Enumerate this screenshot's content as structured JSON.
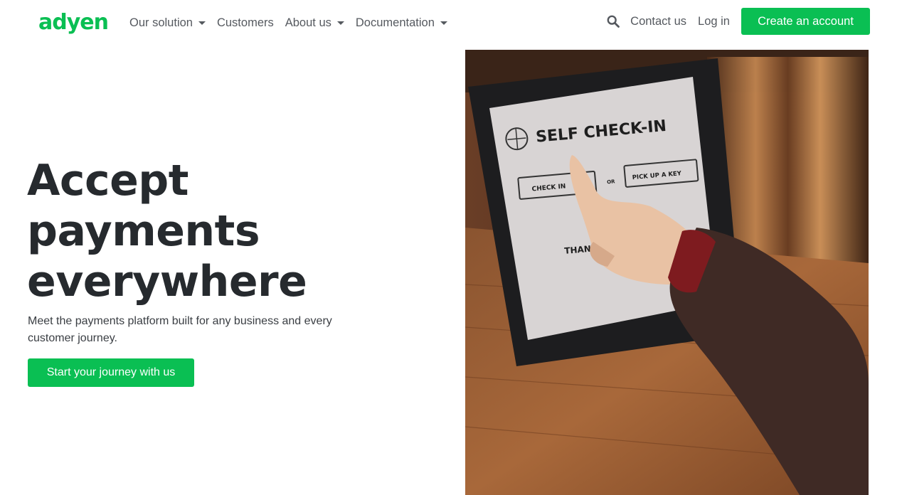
{
  "header": {
    "logo_text": "adyen",
    "nav": [
      {
        "label": "Our solution",
        "has_dropdown": true
      },
      {
        "label": "Customers",
        "has_dropdown": false
      },
      {
        "label": "About us",
        "has_dropdown": true
      },
      {
        "label": "Documentation",
        "has_dropdown": true
      }
    ],
    "search_icon": "search-icon",
    "contact_label": "Contact us",
    "login_label": "Log in",
    "cta_label": "Create an account"
  },
  "hero": {
    "title_lines": [
      "Accept",
      "payments",
      "everywhere"
    ],
    "subtitle_lines": [
      "Meet the payments platform built for any business and every",
      "customer journey."
    ],
    "button_label": "Start your journey with us"
  },
  "video": {
    "screen_title": "SELF CHECK-IN",
    "button_left": "CHECK IN",
    "or_label": "OR",
    "button_right": "PICK UP A KEY",
    "thanks_label": "THAN"
  },
  "colors": {
    "brand_green": "#0abf53",
    "nav_text": "#55595f",
    "heading": "#262a2e"
  }
}
